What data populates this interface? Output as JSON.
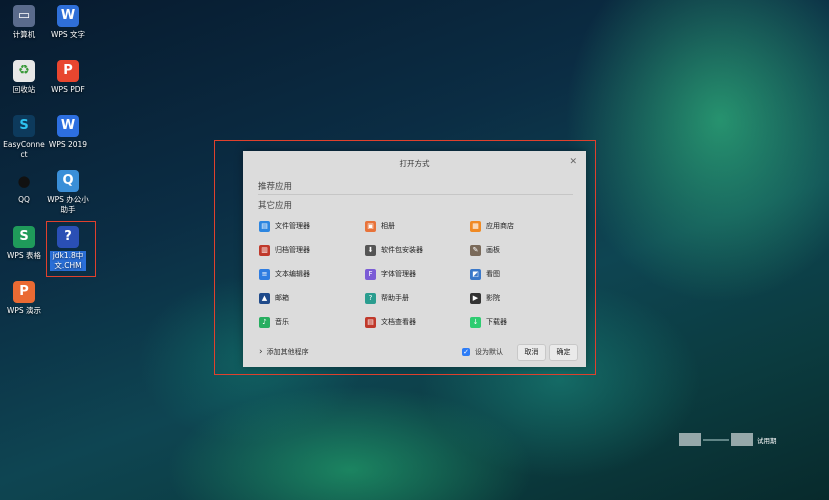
{
  "desktop": {
    "icons": [
      {
        "label": "计算机"
      },
      {
        "label": "WPS 文字"
      },
      {
        "label": "回收站"
      },
      {
        "label": "WPS PDF"
      },
      {
        "label": "EasyConne ct"
      },
      {
        "label": "WPS 2019"
      },
      {
        "label": "QQ"
      },
      {
        "label": "WPS 办公小助手"
      },
      {
        "label": "WPS 表格"
      },
      {
        "label": "jdk1.8中文.CHM"
      },
      {
        "label": "WPS 演示"
      }
    ],
    "trial_text": "试用期"
  },
  "dialog": {
    "title": "打开方式",
    "recommended_label": "推荐应用",
    "other_label": "其它应用",
    "apps": [
      {
        "label": "文件管理器",
        "icon": "folder-icon",
        "color": "#2d86e0"
      },
      {
        "label": "相册",
        "icon": "album-icon",
        "color": "#e8733a"
      },
      {
        "label": "应用商店",
        "icon": "store-icon",
        "color": "#f08a24"
      },
      {
        "label": "归档管理器",
        "icon": "archive-icon",
        "color": "#c0392b"
      },
      {
        "label": "软件包安装器",
        "icon": "package-icon",
        "color": "#555555"
      },
      {
        "label": "画板",
        "icon": "paint-icon",
        "color": "#7a6a5a"
      },
      {
        "label": "文本编辑器",
        "icon": "text-editor-icon",
        "color": "#2f7de1"
      },
      {
        "label": "字体管理器",
        "icon": "font-icon",
        "color": "#7b5cd6"
      },
      {
        "label": "看图",
        "icon": "image-viewer-icon",
        "color": "#3a78c9"
      },
      {
        "label": "邮箱",
        "icon": "mail-icon",
        "color": "#1f4a8a"
      },
      {
        "label": "帮助手册",
        "icon": "manual-icon",
        "color": "#2a9d8f"
      },
      {
        "label": "影院",
        "icon": "movie-icon",
        "color": "#333333"
      },
      {
        "label": "音乐",
        "icon": "music-icon",
        "color": "#27ae60"
      },
      {
        "label": "文档查看器",
        "icon": "document-viewer-icon",
        "color": "#c0392b"
      },
      {
        "label": "下载器",
        "icon": "download-icon",
        "color": "#2ecc71"
      }
    ],
    "add_other": "添加其他程序",
    "set_default": "设为默认",
    "cancel": "取消",
    "confirm": "确定"
  }
}
